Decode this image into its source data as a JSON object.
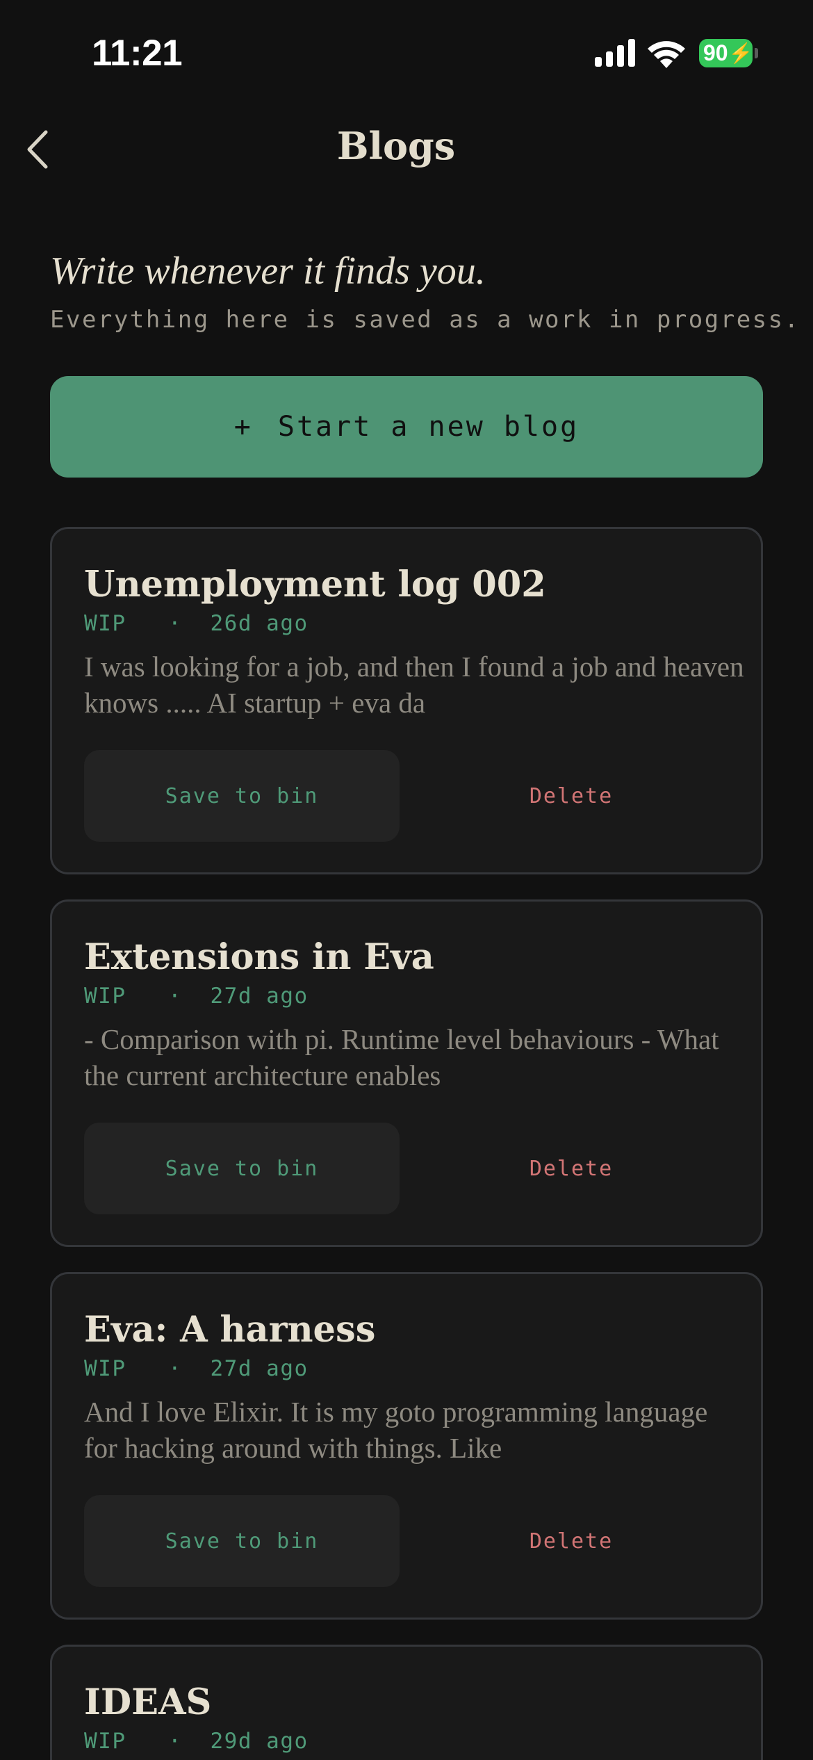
{
  "status_bar": {
    "time": "11:21",
    "battery_level": "90",
    "icons": [
      "cellular-signal-icon",
      "wifi-icon",
      "battery-charging-icon"
    ]
  },
  "nav": {
    "back_icon": "chevron-left-icon",
    "title": "Blogs"
  },
  "intro": {
    "tagline": "Write whenever it finds you.",
    "subtitle": "Everything here is saved as a work in progress."
  },
  "new_blog_button": {
    "icon": "plus",
    "label": "Start a new blog"
  },
  "posts": [
    {
      "title": "Unemployment log 002",
      "status": "WIP",
      "separator": "·",
      "age": "26d ago",
      "excerpt": "I was looking for a job, and then I found a job and heaven knows ..... AI startup + eva da",
      "save_label": "Save to bin",
      "delete_label": "Delete"
    },
    {
      "title": "Extensions in Eva",
      "status": "WIP",
      "separator": "·",
      "age": "27d ago",
      "excerpt": "- Comparison with pi. Runtime level behaviours - What the current architecture enables",
      "save_label": "Save to bin",
      "delete_label": "Delete"
    },
    {
      "title": "Eva: A harness",
      "status": "WIP",
      "separator": "·",
      "age": "27d ago",
      "excerpt": "And I love Elixir. It is my goto programming language for hacking around with things. Like",
      "save_label": "Save to bin",
      "delete_label": "Delete"
    },
    {
      "title": "IDEAS",
      "status": "WIP",
      "separator": "·",
      "age": "29d ago"
    }
  ],
  "colors": {
    "background": "#111111",
    "accent_green": "#4e9474",
    "meta_green": "#4f9a78",
    "delete_red": "#d27575",
    "card_bg": "#191919",
    "card_border": "#34363a"
  }
}
